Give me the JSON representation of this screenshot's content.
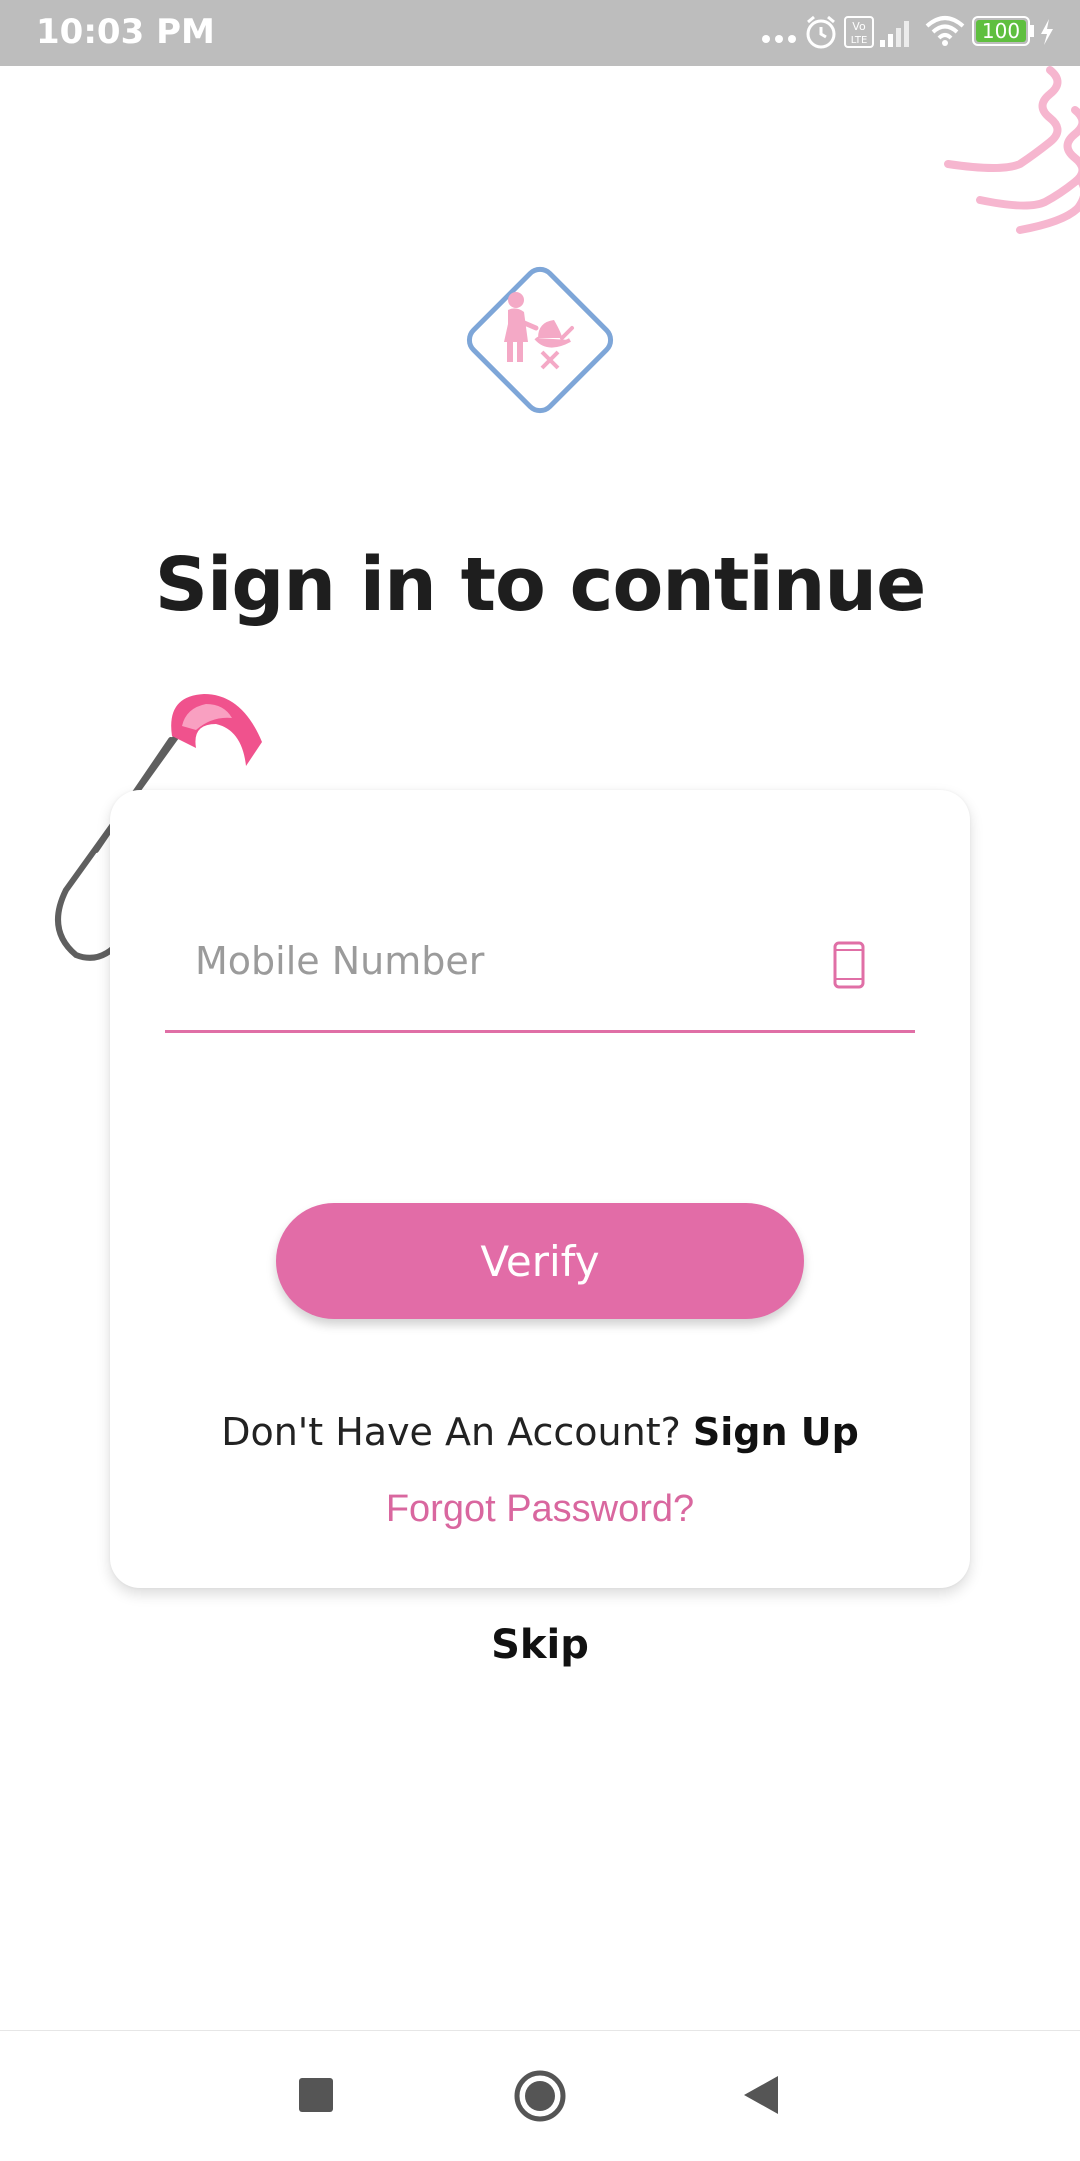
{
  "status_bar": {
    "time": "10:03 PM",
    "battery": "100",
    "icons": [
      "more-dots-icon",
      "alarm-icon",
      "volte-icon",
      "signal-icon",
      "wifi-icon",
      "battery-icon",
      "charging-icon"
    ]
  },
  "header": {
    "title": "Sign in to continue"
  },
  "form": {
    "mobile_placeholder": "Mobile Number",
    "mobile_value": "",
    "verify_label": "Verify",
    "no_account_text": "Don't Have An Account?",
    "sign_up_label": "Sign Up",
    "forgot_label": "Forgot Password?"
  },
  "skip_label": "Skip",
  "colors": {
    "accent": "#e26ca7",
    "logo_outline": "#7ea6d8",
    "status_bar": "#bdbdbd"
  },
  "nav": {
    "icons": [
      "recents-square-icon",
      "home-circle-icon",
      "back-triangle-icon"
    ]
  }
}
